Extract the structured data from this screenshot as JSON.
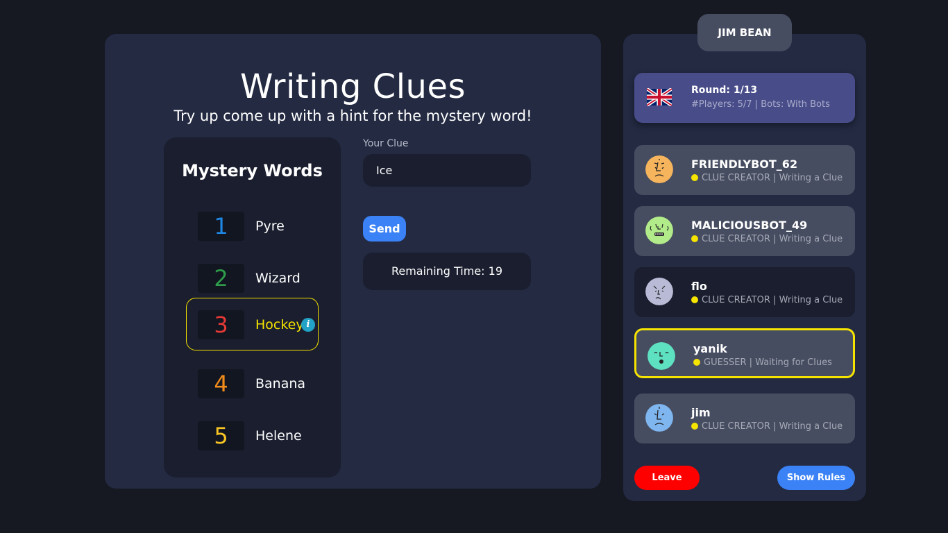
{
  "header": {
    "title": "Writing Clues",
    "subtitle": "Try up come up with a hint for the mystery word!"
  },
  "mystery_words": {
    "title": "Mystery Words",
    "items": [
      {
        "number": "1",
        "label": "Pyre",
        "color": "#1e88e5"
      },
      {
        "number": "2",
        "label": "Wizard",
        "color": "#2e9c4a"
      },
      {
        "number": "3",
        "label": "Hockey",
        "color": "#e53935",
        "selected": true
      },
      {
        "number": "4",
        "label": "Banana",
        "color": "#f28c1a"
      },
      {
        "number": "5",
        "label": "Helene",
        "color": "#f7c523"
      }
    ],
    "info_icon": "info-icon"
  },
  "clue": {
    "label": "Your Clue",
    "value": "Ice",
    "send_label": "Send",
    "remaining_time": "Remaining Time: 19"
  },
  "sidebar": {
    "username": "JIM BEAN",
    "round": {
      "title": "Round: 1/13",
      "info": "#Players: 5/7 | Bots: With Bots",
      "flag_icon": "uk-flag-icon"
    },
    "players": [
      {
        "name": "FRIENDLYBOT_62",
        "status": "CLUE CREATOR | Writing a Clue",
        "avatar_color": "#f6b55d"
      },
      {
        "name": "MALICIOUSBOT_49",
        "status": "CLUE CREATOR | Writing a Clue",
        "avatar_color": "#b2ec8a"
      },
      {
        "name": "flo",
        "status": "CLUE CREATOR | Writing a Clue",
        "avatar_color": "#b9bbd6"
      },
      {
        "name": "yanik",
        "status": "GUESSER | Waiting for Clues",
        "avatar_color": "#5ee1c1"
      },
      {
        "name": "jim",
        "status": "CLUE CREATOR | Writing a Clue",
        "avatar_color": "#7fb6ef"
      }
    ],
    "leave_label": "Leave",
    "rules_label": "Show Rules"
  },
  "colors": {
    "background": "#161922",
    "panel": "#232a42",
    "accent_blue": "#3b82f6",
    "highlight_yellow": "#f5e300",
    "leave_red": "#ff0000"
  }
}
